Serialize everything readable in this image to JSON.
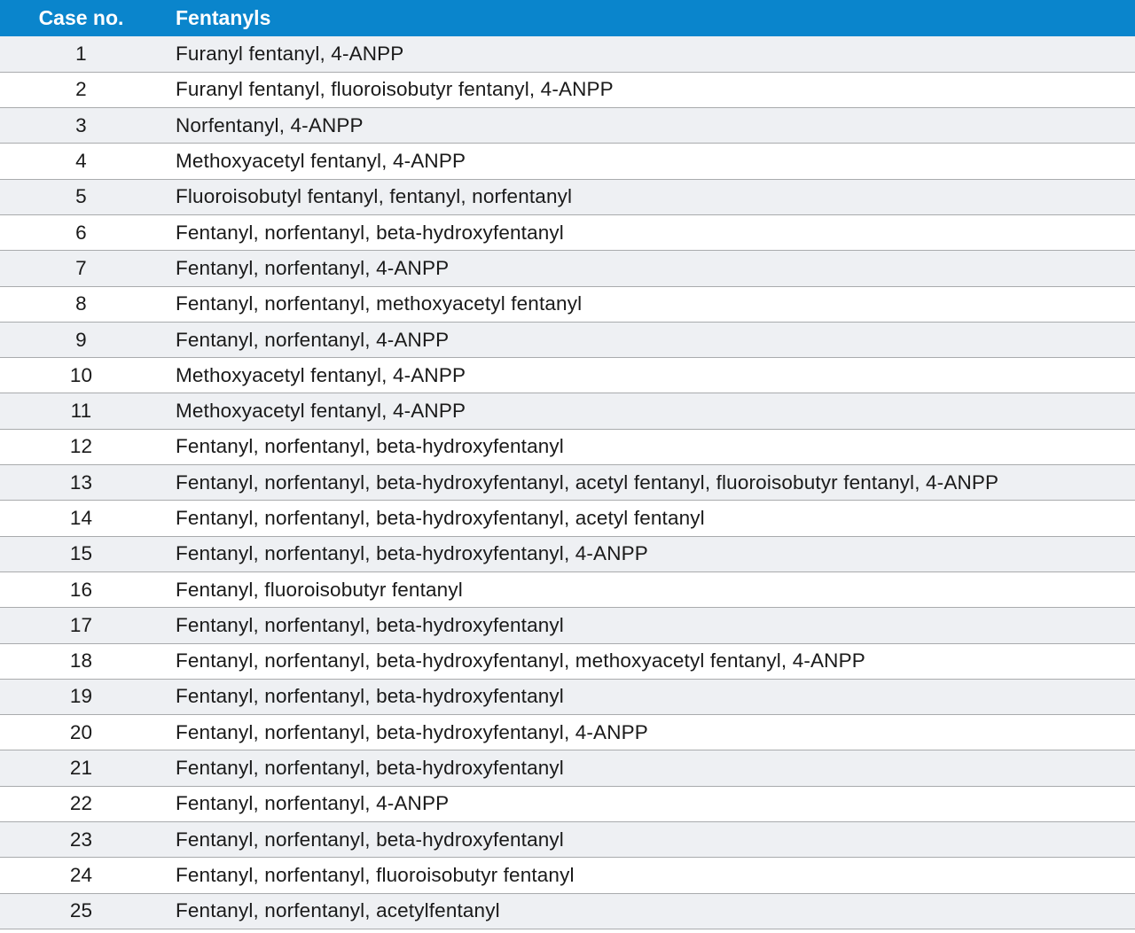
{
  "table": {
    "headers": [
      "Case no.",
      "Fentanyls"
    ],
    "rows": [
      {
        "case": "1",
        "fentanyls": "Furanyl fentanyl, 4-ANPP"
      },
      {
        "case": "2",
        "fentanyls": "Furanyl fentanyl, fluoroisobutyr fentanyl, 4-ANPP"
      },
      {
        "case": "3",
        "fentanyls": "Norfentanyl, 4-ANPP"
      },
      {
        "case": "4",
        "fentanyls": "Methoxyacetyl fentanyl, 4-ANPP"
      },
      {
        "case": "5",
        "fentanyls": "Fluoroisobutyl fentanyl, fentanyl, norfentanyl"
      },
      {
        "case": "6",
        "fentanyls": "Fentanyl, norfentanyl, beta-hydroxyfentanyl"
      },
      {
        "case": "7",
        "fentanyls": "Fentanyl, norfentanyl, 4-ANPP"
      },
      {
        "case": "8",
        "fentanyls": "Fentanyl, norfentanyl, methoxyacetyl fentanyl"
      },
      {
        "case": "9",
        "fentanyls": "Fentanyl, norfentanyl, 4-ANPP"
      },
      {
        "case": "10",
        "fentanyls": "Methoxyacetyl fentanyl, 4-ANPP"
      },
      {
        "case": "11",
        "fentanyls": "Methoxyacetyl fentanyl, 4-ANPP"
      },
      {
        "case": "12",
        "fentanyls": "Fentanyl, norfentanyl, beta-hydroxyfentanyl"
      },
      {
        "case": "13",
        "fentanyls": "Fentanyl, norfentanyl, beta-hydroxyfentanyl, acetyl fentanyl, fluoroisobutyr fentanyl, 4-ANPP"
      },
      {
        "case": "14",
        "fentanyls": "Fentanyl, norfentanyl, beta-hydroxyfentanyl, acetyl fentanyl"
      },
      {
        "case": "15",
        "fentanyls": "Fentanyl, norfentanyl, beta-hydroxyfentanyl, 4-ANPP"
      },
      {
        "case": "16",
        "fentanyls": "Fentanyl, fluoroisobutyr fentanyl"
      },
      {
        "case": "17",
        "fentanyls": "Fentanyl, norfentanyl, beta-hydroxyfentanyl"
      },
      {
        "case": "18",
        "fentanyls": "Fentanyl, norfentanyl, beta-hydroxyfentanyl, methoxyacetyl fentanyl, 4-ANPP"
      },
      {
        "case": "19",
        "fentanyls": "Fentanyl, norfentanyl, beta-hydroxyfentanyl"
      },
      {
        "case": "20",
        "fentanyls": "Fentanyl, norfentanyl, beta-hydroxyfentanyl, 4-ANPP"
      },
      {
        "case": "21",
        "fentanyls": "Fentanyl, norfentanyl, beta-hydroxyfentanyl"
      },
      {
        "case": "22",
        "fentanyls": "Fentanyl, norfentanyl, 4-ANPP"
      },
      {
        "case": "23",
        "fentanyls": "Fentanyl, norfentanyl, beta-hydroxyfentanyl"
      },
      {
        "case": "24",
        "fentanyls": "Fentanyl, norfentanyl, fluoroisobutyr fentanyl"
      },
      {
        "case": "25",
        "fentanyls": "Fentanyl, norfentanyl, acetylfentanyl"
      }
    ]
  },
  "colors": {
    "header_bg": "#0a85cc",
    "header_text": "#ffffff",
    "row_alt_bg": "#eef0f3",
    "row_bg": "#ffffff",
    "divider": "#a9abad"
  }
}
